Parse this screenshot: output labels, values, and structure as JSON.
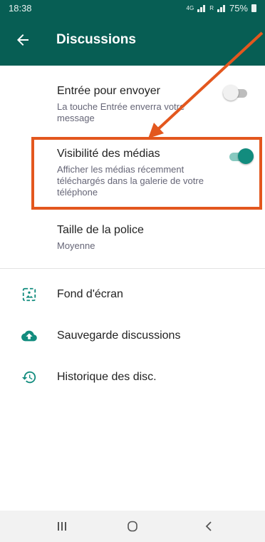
{
  "status_bar": {
    "time": "18:38",
    "network": "4G",
    "sim": "R",
    "battery": "75%"
  },
  "app_bar": {
    "title": "Discussions"
  },
  "settings": [
    {
      "title": "Entrée pour envoyer",
      "subtitle": "La touche Entrée enverra votre message",
      "toggle": false
    },
    {
      "title": "Visibilité des médias",
      "subtitle": "Afficher les médias récemment téléchargés dans la galerie de votre téléphone",
      "toggle": true
    },
    {
      "title": "Taille de la police",
      "subtitle": "Moyenne"
    }
  ],
  "menu": [
    {
      "label": "Fond d'écran",
      "icon": "wallpaper-icon"
    },
    {
      "label": "Sauvegarde discussions",
      "icon": "cloud-upload-icon"
    },
    {
      "label": "Historique des disc.",
      "icon": "history-icon"
    }
  ],
  "colors": {
    "primary": "#075e54",
    "accent": "#128c7e",
    "annotation": "#e3571e"
  }
}
